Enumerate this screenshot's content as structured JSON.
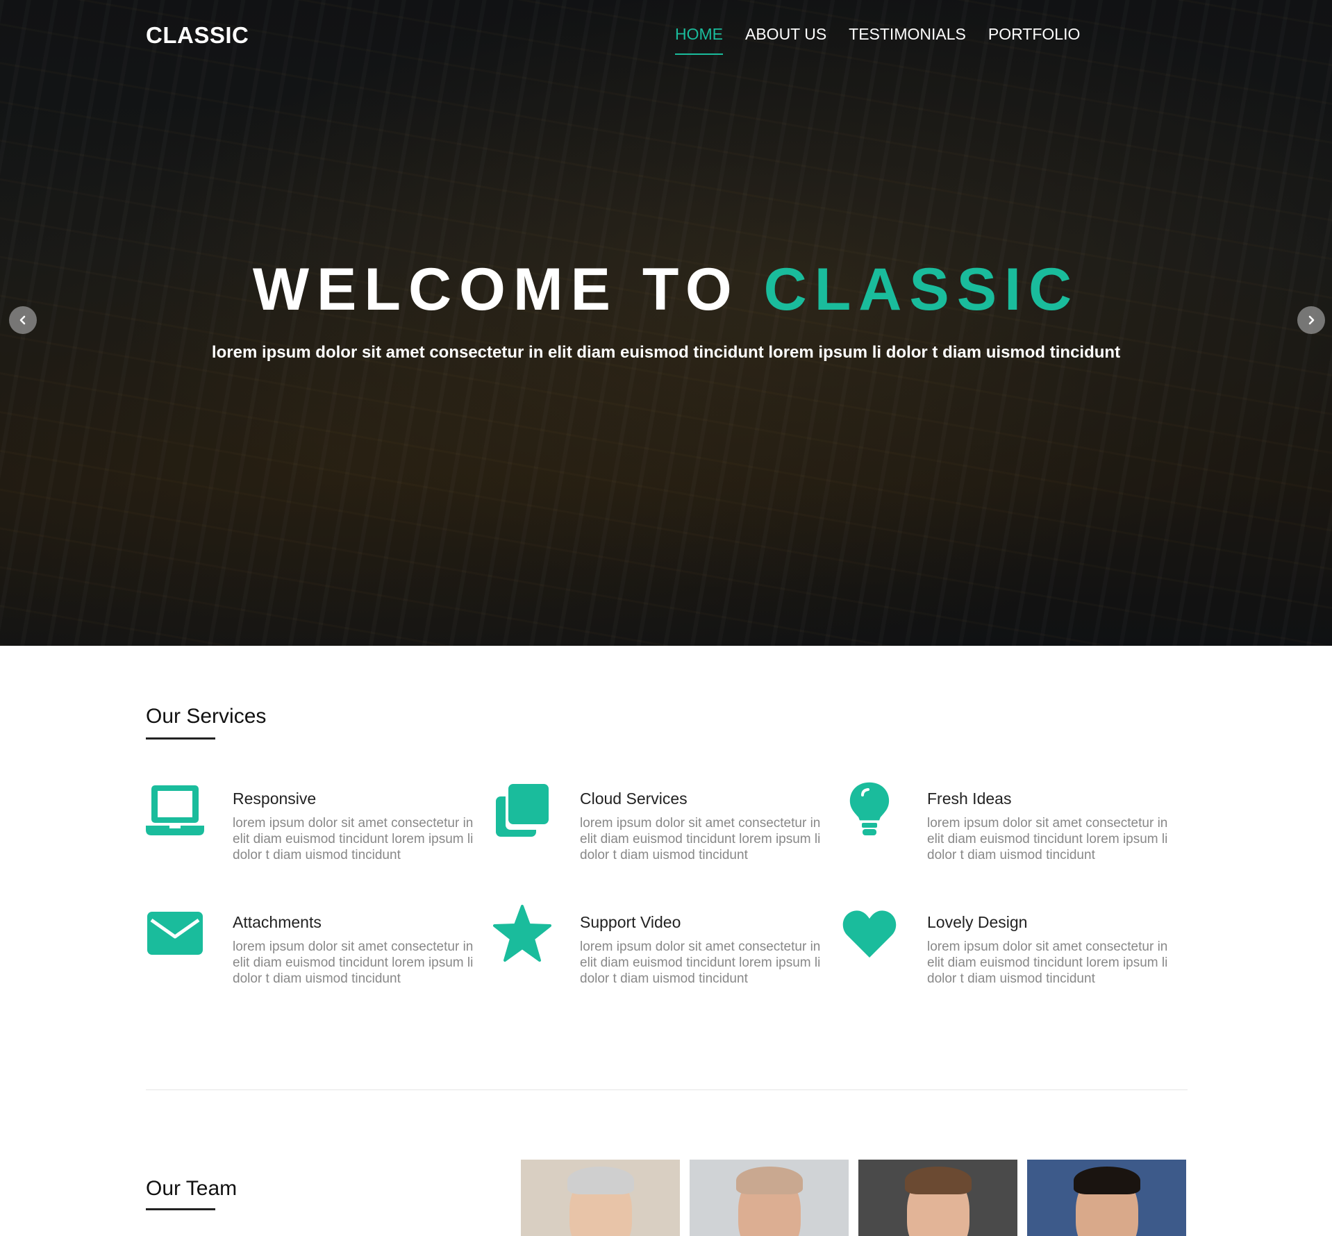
{
  "brand": {
    "logo": "CLASSIC",
    "accent_color": "#1abc9c"
  },
  "nav": {
    "items": [
      {
        "label": "HOME",
        "active": true
      },
      {
        "label": "ABOUT US",
        "active": false
      },
      {
        "label": "TESTIMONIALS",
        "active": false
      },
      {
        "label": "PORTFOLIO",
        "active": false
      }
    ]
  },
  "hero": {
    "title_prefix": "WELCOME TO",
    "title_accent": "CLASSIC",
    "subtitle": "lorem ipsum dolor sit amet consectetur in elit diam euismod tincidunt lorem ipsum li dolor t diam uismod tincidunt",
    "prev_icon": "chevron-left-icon",
    "next_icon": "chevron-right-icon"
  },
  "services": {
    "title": "Our Services",
    "items": [
      {
        "title": "Responsive",
        "icon": "laptop-icon",
        "description": "lorem ipsum dolor sit amet consectetur in elit diam euismod tincidunt lorem ipsum li dolor t diam uismod tincidunt"
      },
      {
        "title": "Cloud Services",
        "icon": "clone-icon",
        "description": "lorem ipsum dolor sit amet consectetur in elit diam euismod tincidunt lorem ipsum li dolor t diam uismod tincidunt"
      },
      {
        "title": "Fresh Ideas",
        "icon": "lightbulb-icon",
        "description": "lorem ipsum dolor sit amet consectetur in elit diam euismod tincidunt lorem ipsum li dolor t diam uismod tincidunt"
      },
      {
        "title": "Attachments",
        "icon": "envelope-icon",
        "description": "lorem ipsum dolor sit amet consectetur in elit diam euismod tincidunt lorem ipsum li dolor t diam uismod tincidunt"
      },
      {
        "title": "Support Video",
        "icon": "star-icon",
        "description": "lorem ipsum dolor sit amet consectetur in elit diam euismod tincidunt lorem ipsum li dolor t diam uismod tincidunt"
      },
      {
        "title": "Lovely Design",
        "icon": "heart-icon",
        "description": "lorem ipsum dolor sit amet consectetur in elit diam euismod tincidunt lorem ipsum li dolor t diam uismod tincidunt"
      }
    ]
  },
  "team": {
    "title": "Our Team",
    "members": [
      {
        "photo": "team-member-photo-1",
        "bg": "#d9cfc2",
        "skin": "#e8c4a8",
        "hair": "#cfcfcf"
      },
      {
        "photo": "team-member-photo-2",
        "bg": "#d0d3d6",
        "skin": "#dcae92",
        "hair": "#c9a890"
      },
      {
        "photo": "team-member-photo-3",
        "bg": "#4a4a4a",
        "skin": "#e2b497",
        "hair": "#6b4a32"
      },
      {
        "photo": "team-member-photo-4",
        "bg": "#3d5a8a",
        "skin": "#d9a98a",
        "hair": "#1a1410"
      }
    ]
  }
}
